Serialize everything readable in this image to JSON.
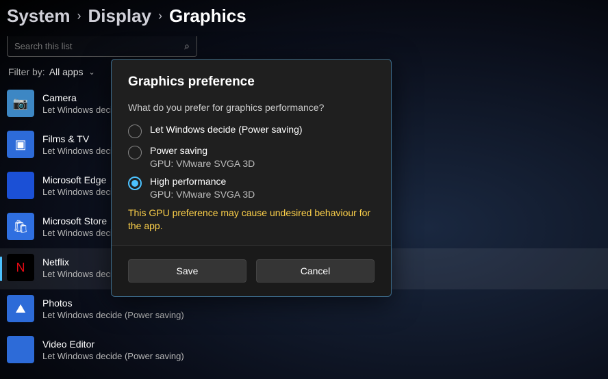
{
  "breadcrumb": {
    "a": "System",
    "b": "Display",
    "c": "Graphics"
  },
  "search": {
    "placeholder": "Search this list"
  },
  "filter": {
    "label": "Filter by:",
    "value": "All apps"
  },
  "apps": [
    {
      "name": "Camera",
      "sub": "Let Windows decide (Power saving)",
      "iconBg": "#3d87c4",
      "glyph": "📷"
    },
    {
      "name": "Films & TV",
      "sub": "Let Windows decide (Power saving)",
      "iconBg": "#2d6bd8",
      "glyph": "▣"
    },
    {
      "name": "Microsoft Edge",
      "sub": "Let Windows decide (Power saving)",
      "iconBg": "#1b50d6",
      "glyph": ""
    },
    {
      "name": "Microsoft Store",
      "sub": "Let Windows decide (Power saving)",
      "iconBg": "#2f6fe0",
      "glyph": "🛍"
    },
    {
      "name": "Netflix",
      "sub": "Let Windows decide (Power saving)",
      "iconBg": "#000",
      "glyph": "N",
      "glyphColor": "#e50914",
      "selected": true
    },
    {
      "name": "Photos",
      "sub": "Let Windows decide (Power saving)",
      "iconBg": "#2d6bd8",
      "glyph": "⛰"
    },
    {
      "name": "Video Editor",
      "sub": "Let Windows decide (Power saving)",
      "iconBg": "#2d6bd8",
      "glyph": ""
    }
  ],
  "dialog": {
    "title": "Graphics preference",
    "question": "What do you prefer for graphics performance?",
    "options": [
      {
        "label": "Let Windows decide (Power saving)",
        "sub": "",
        "checked": false
      },
      {
        "label": "Power saving",
        "sub": "GPU: VMware SVGA 3D",
        "checked": false
      },
      {
        "label": "High performance",
        "sub": "GPU: VMware SVGA 3D",
        "checked": true
      }
    ],
    "warning": "This GPU preference may cause undesired behaviour for the app.",
    "save": "Save",
    "cancel": "Cancel"
  }
}
